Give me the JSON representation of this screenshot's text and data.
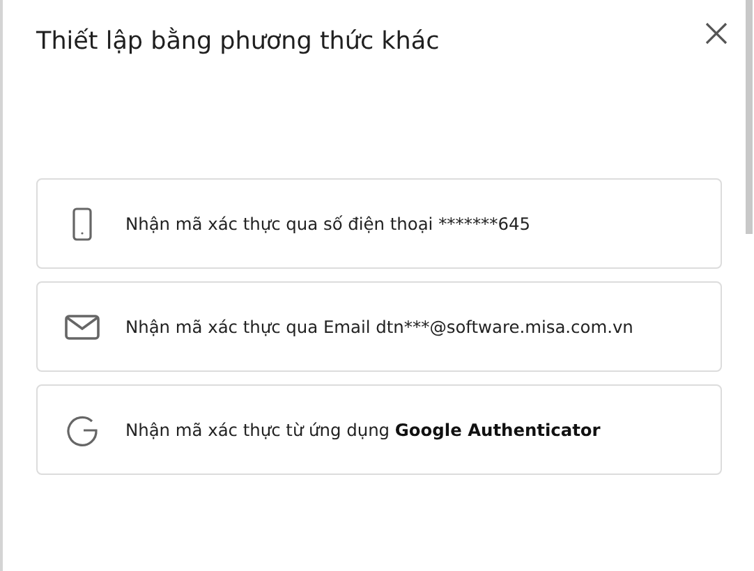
{
  "dialog": {
    "title": "Thiết lập bằng phương thức khác"
  },
  "methods": [
    {
      "kind": "phone",
      "label": "Nhận mã xác thực qua số điện thoại *******645"
    },
    {
      "kind": "email",
      "label": "Nhận mã xác thực qua Email dtn***@software.misa.com.vn"
    },
    {
      "kind": "google",
      "label": "Nhận mã xác thực từ ứng dụng",
      "app_name": "Google Authenticator"
    }
  ]
}
